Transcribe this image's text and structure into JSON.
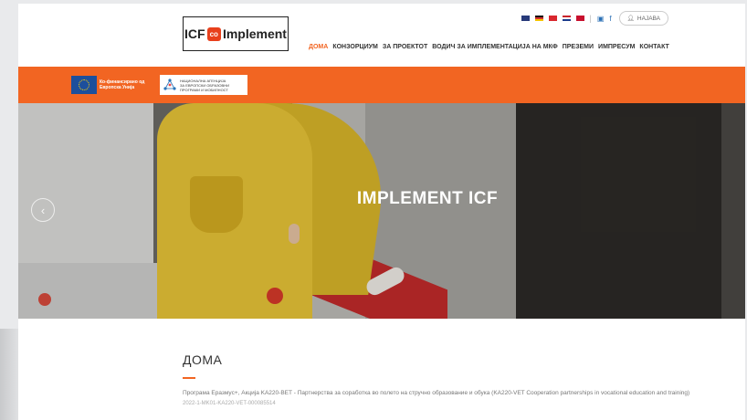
{
  "header": {
    "logo_left": "ICF",
    "logo_mid": "co",
    "logo_right": "Implement",
    "login_label": "НАЈАВА",
    "flags": [
      {
        "name": "uk-flag",
        "color": "#283a7a"
      },
      {
        "name": "de-flag",
        "color": "#d4322c"
      },
      {
        "name": "tr-flag",
        "color": "#d9272e"
      },
      {
        "name": "hr-flag",
        "color": "#c9242b"
      },
      {
        "name": "al-flag",
        "color": "#c8102e"
      }
    ],
    "separator": "|",
    "social_icons": [
      "linkedin-icon",
      "facebook-icon"
    ]
  },
  "nav": {
    "items": [
      {
        "label": "ДОМА",
        "active": true
      },
      {
        "label": "КОНЗОРЦИУМ",
        "active": false
      },
      {
        "label": "ЗА ПРОЕКТОТ",
        "active": false
      },
      {
        "label": "ВОДИЧ ЗА ИМПЛЕМЕНТАЦИЈА НА МКФ",
        "active": false
      },
      {
        "label": "ПРЕЗЕМИ",
        "active": false
      },
      {
        "label": "ИМПРЕСУМ",
        "active": false
      },
      {
        "label": "КОНТАКТ",
        "active": false
      }
    ]
  },
  "band": {
    "eu_text_1": "Ко-финансирано од",
    "eu_text_2": "Европска Унија",
    "agency_text_1": "НАЦИОНАЛНА АГЕНЦИЈА",
    "agency_text_2": "ЗА ЕВРОПСКИ ОБРАЗОВНИ",
    "agency_text_3": "ПРОГРАМИ И МОБИЛНОСТ",
    "color": "#f26522"
  },
  "hero": {
    "title": "IMPLEMENT ICF",
    "prev_glyph": "‹"
  },
  "content": {
    "heading": "ДОМА",
    "paragraph": "Програма Еразмус+, Акција KA220-ВЕТ - Партнерства за соработка во полето на стручно образование и обука (KA220-VET Cooperation partnerships in vocational education and training)",
    "reference": "2022-1-MK01-KA220-VET-000085514"
  },
  "colors": {
    "accent": "#f26522"
  }
}
